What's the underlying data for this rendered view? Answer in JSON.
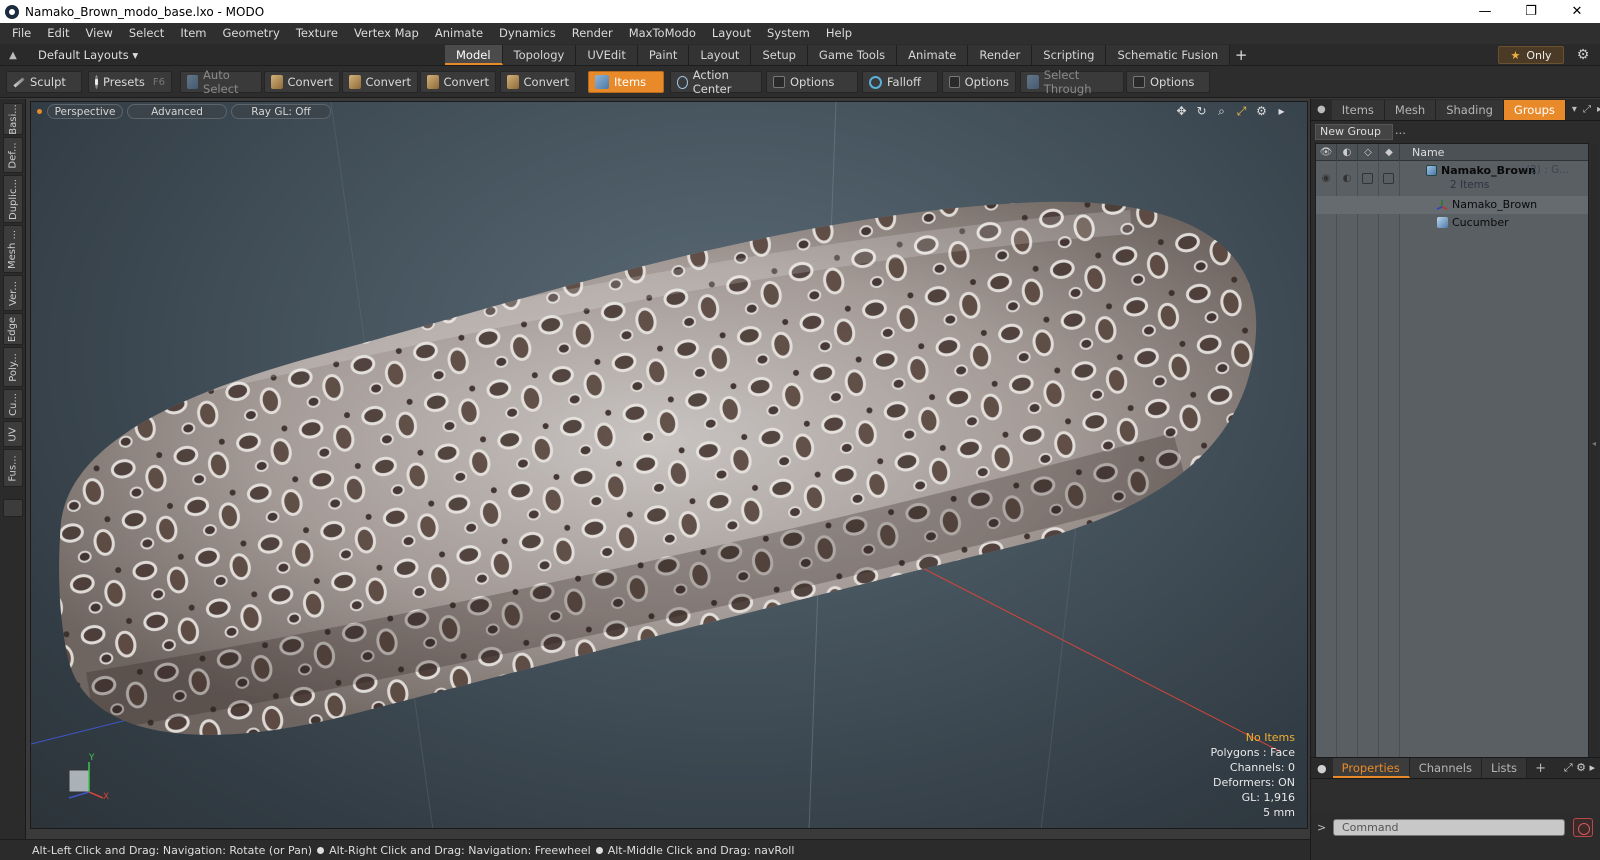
{
  "window": {
    "title": "Namako_Brown_modo_base.lxo - MODO",
    "controls": {
      "minimize": "—",
      "maximize": "❐",
      "close": "✕"
    }
  },
  "menu": [
    "File",
    "Edit",
    "View",
    "Select",
    "Item",
    "Geometry",
    "Texture",
    "Vertex Map",
    "Animate",
    "Dynamics",
    "Render",
    "MaxToModo",
    "Layout",
    "System",
    "Help"
  ],
  "layout": {
    "selector": "Default Layouts ▾",
    "tabs": [
      "Model",
      "Topology",
      "UVEdit",
      "Paint",
      "Layout",
      "Setup",
      "Game Tools",
      "Animate",
      "Render",
      "Scripting",
      "Schematic Fusion"
    ],
    "active_tab": "Model",
    "add_tab": "+",
    "only_label": "Only"
  },
  "toolbar": {
    "sculpt": "Sculpt",
    "presets": "Presets",
    "presets_hotkey": "F6",
    "auto_select": "Auto Select",
    "convert1": "Convert",
    "convert2": "Convert",
    "convert3": "Convert",
    "convert4": "Convert",
    "items": "Items",
    "action_center": "Action Center",
    "options1": "Options",
    "falloff": "Falloff",
    "options2": "Options",
    "select_through": "Select Through",
    "options3": "Options"
  },
  "left_tabs": [
    "Basi...",
    "Def...",
    "Duplic...",
    "Mesh ...",
    "Ver...",
    "Edge",
    "Poly...",
    "Cu...",
    "UV",
    "Fus..."
  ],
  "viewport": {
    "view_mode": "Perspective",
    "shading": "Advanced",
    "raygl": "Ray GL: Off",
    "stats": {
      "no_items": "No Items",
      "polygons": "Polygons : Face",
      "channels": "Channels: 0",
      "deformers": "Deformers: ON",
      "gl": "GL: 1,916",
      "scale": "5 mm"
    },
    "axis": {
      "y": "Y",
      "x": "X"
    }
  },
  "statusbar": {
    "hint1": "Alt-Left Click and Drag: Navigation: Rotate (or Pan)",
    "hint2": "Alt-Right Click and Drag: Navigation: Freewheel",
    "hint3": "Alt-Middle Click and Drag: navRoll"
  },
  "right_panel": {
    "tabs": [
      "Items",
      "Mesh ...",
      "Shading",
      "Groups"
    ],
    "active_tab": "Groups",
    "new_group": "New Group",
    "column_name": "Name",
    "tree": {
      "group_name": "Namako_Brown",
      "group_suffix": "(2) : G...",
      "group_count": "2 Items",
      "children": [
        "Namako_Brown",
        "Cucumber"
      ]
    },
    "bottom_tabs": [
      "Properties",
      "Channels",
      "Lists"
    ],
    "bottom_active": "Properties",
    "command_placeholder": "Command"
  },
  "colors": {
    "accent": "#e98a2a",
    "viewport_bg": "#46545e",
    "tree_bg": "#5a5f63"
  }
}
